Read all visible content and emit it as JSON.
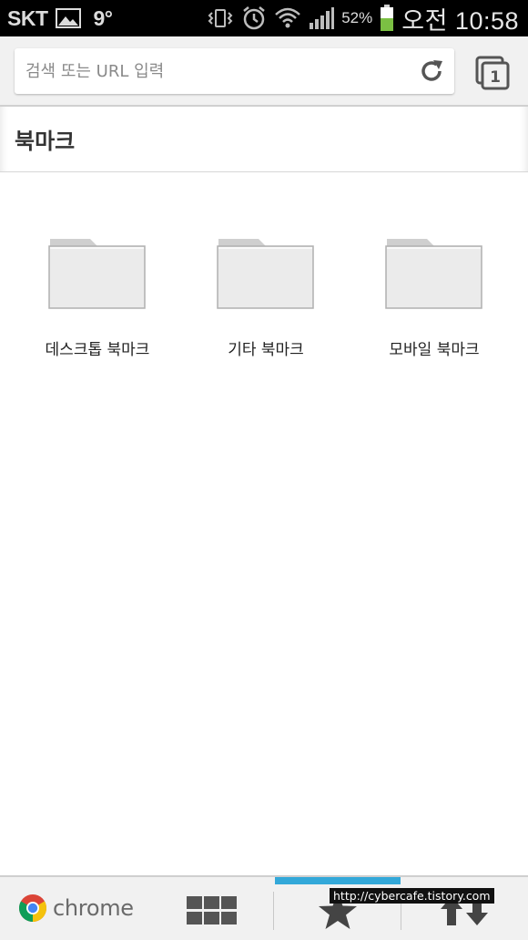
{
  "status_bar": {
    "carrier": "SKT",
    "temperature": "9°",
    "battery_percent": "52%",
    "clock": "오전 10:58",
    "battery_level": 0.52,
    "battery_color": "#7bc043"
  },
  "toolbar": {
    "url_placeholder": "검색 또는 URL 입력",
    "tab_count": "1"
  },
  "header": {
    "title": "북마크"
  },
  "folders": [
    {
      "label": "데스크톱 북마크"
    },
    {
      "label": "기타 북마크"
    },
    {
      "label": "모바일 북마크"
    }
  ],
  "bottom_bar": {
    "brand": "chrome",
    "active_tab": "bookmarks",
    "accent_color": "#33a8d9",
    "watermark": "http://cybercafe.tistory.com"
  },
  "icons": {
    "reload": "reload-icon",
    "tabs": "tab-switcher-icon",
    "most_visited": "grid-icon",
    "bookmarks": "star-icon",
    "other_devices": "sync-arrows-icon"
  }
}
